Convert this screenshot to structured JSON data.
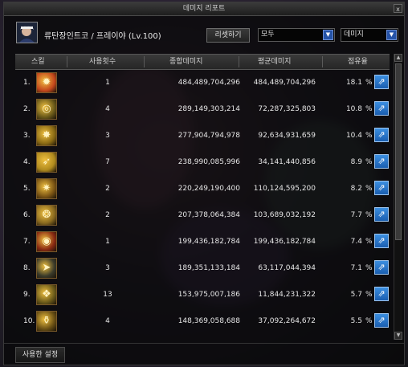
{
  "window": {
    "title": "데미지 리포트",
    "close_label": "x"
  },
  "header": {
    "character_name": "류탄장인트코 / 프레이야 (Lv.100)",
    "reset_label": "리셋하기",
    "filter_select": "모두",
    "mode_select": "데미지"
  },
  "columns": {
    "skill": "스킬",
    "uses": "사용횟수",
    "total_damage": "종합데미지",
    "avg_damage": "평균데미지",
    "share": "점유율"
  },
  "rows": [
    {
      "rank": "1.",
      "count": "1",
      "total": "484,489,704,296",
      "avg": "484,489,704,296",
      "pct": "18.1",
      "pct_unit": "%",
      "icon": "explosion-icon",
      "color": "#c4481c",
      "glyph": "✹"
    },
    {
      "rank": "2.",
      "count": "4",
      "total": "289,149,303,214",
      "avg": "72,287,325,803",
      "pct": "10.8",
      "pct_unit": "%",
      "icon": "ring-icon",
      "color": "#6b5a1a",
      "glyph": "◎"
    },
    {
      "rank": "3.",
      "count": "3",
      "total": "277,904,794,978",
      "avg": "92,634,931,659",
      "pct": "10.4",
      "pct_unit": "%",
      "icon": "burst-icon",
      "color": "#8a6a14",
      "glyph": "✸"
    },
    {
      "rank": "4.",
      "count": "7",
      "total": "238,990,085,996",
      "avg": "34,141,440,856",
      "pct": "8.9",
      "pct_unit": "%",
      "icon": "beam-icon",
      "color": "#b08a1e",
      "glyph": "➶"
    },
    {
      "rank": "5.",
      "count": "2",
      "total": "220,249,190,400",
      "avg": "110,124,595,200",
      "pct": "8.2",
      "pct_unit": "%",
      "icon": "spark-icon",
      "color": "#7a5414",
      "glyph": "✷"
    },
    {
      "rank": "6.",
      "count": "2",
      "total": "207,378,064,384",
      "avg": "103,689,032,192",
      "pct": "7.7",
      "pct_unit": "%",
      "icon": "claw-icon",
      "color": "#8a6a20",
      "glyph": "❂"
    },
    {
      "rank": "7.",
      "count": "1",
      "total": "199,436,182,784",
      "avg": "199,436,182,784",
      "pct": "7.4",
      "pct_unit": "%",
      "icon": "eye-icon",
      "color": "#8a2a12",
      "glyph": "◉"
    },
    {
      "rank": "8.",
      "count": "3",
      "total": "189,351,133,184",
      "avg": "63,117,044,394",
      "pct": "7.1",
      "pct_unit": "%",
      "icon": "arrow-icon",
      "color": "#3a3a2a",
      "glyph": "➤"
    },
    {
      "rank": "9.",
      "count": "13",
      "total": "153,975,007,186",
      "avg": "11,844,231,322",
      "pct": "5.7",
      "pct_unit": "%",
      "icon": "grenade-icon",
      "color": "#6a5a1a",
      "glyph": "❖"
    },
    {
      "rank": "10.",
      "count": "4",
      "total": "148,369,058,688",
      "avg": "37,092,264,672",
      "pct": "5.5",
      "pct_unit": "%",
      "icon": "barrel-icon",
      "color": "#6a5014",
      "glyph": "⚱"
    }
  ],
  "footer": {
    "settings_label": "사용한 설정"
  },
  "colors": {
    "share_button": "#2a74c8",
    "accent_arrow": "#2553a8"
  }
}
